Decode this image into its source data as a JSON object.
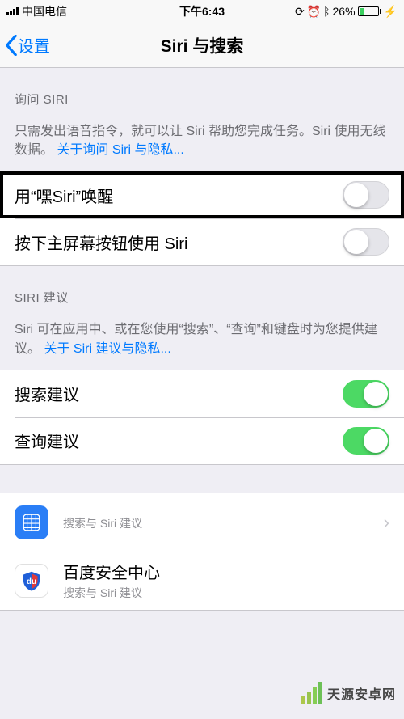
{
  "status": {
    "carrier": "中国电信",
    "time": "下午6:43",
    "battery_pct": "26%"
  },
  "nav": {
    "back_label": "设置",
    "title": "Siri 与搜索"
  },
  "sections": {
    "ask_siri": {
      "header": "询问 SIRI",
      "footer_text": "只需发出语音指令，就可以让 Siri 帮助您完成任务。Siri 使用无线数据。",
      "footer_link": "关于询问 Siri 与隐私..."
    },
    "siri_suggestions": {
      "header": "SIRI 建议",
      "footer_text": "Siri 可在应用中、或在您使用“搜索”、“查询”和键盘时为您提供建议。",
      "footer_link": "关于 Siri 建议与隐私..."
    }
  },
  "rows": {
    "hey_siri": {
      "label": "用“嘿Siri”唤醒",
      "on": false
    },
    "press_home": {
      "label": "按下主屏幕按钮使用 Siri",
      "on": false
    },
    "search_sugg": {
      "label": "搜索建议",
      "on": true
    },
    "lookup_sugg": {
      "label": "查询建议",
      "on": true
    }
  },
  "apps": [
    {
      "name": "",
      "sub": "搜索与 Siri 建议",
      "icon": "safari"
    },
    {
      "name": "百度安全中心",
      "sub": "搜索与 Siri 建议",
      "icon": "baidu"
    }
  ],
  "watermark": "天源安卓网"
}
